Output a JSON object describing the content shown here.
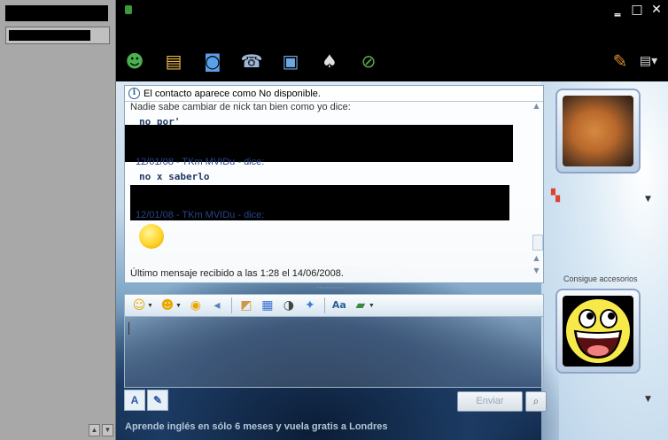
{
  "window": {
    "controls": [
      "minimize",
      "maximize",
      "close"
    ]
  },
  "toolbar": {
    "icons": [
      "invite-contact-icon",
      "send-files-icon",
      "video-icon",
      "call-icon",
      "activities-icon",
      "games-icon",
      "block-icon"
    ],
    "right_icons": [
      "paint-brush-icon",
      "menu-icon"
    ]
  },
  "history": {
    "info_text": "El contacto aparece como No disponible.",
    "lines": [
      "Nadie sabe cambiar de nick tan bien como yo dice:",
      "no por'",
      "12/01/08  -  TKm MVIDu  -  dice:",
      "no x saberlo",
      "12/01/08  -  TKm MVIDu  -  dice:"
    ],
    "last_message": "Último mensaje recibido a las 1:28 el 14/06/2008."
  },
  "format_toolbar": {
    "icons": [
      "emoticon-icon",
      "wink-icon",
      "nudge-icon",
      "voice-clip-icon",
      "background-icon",
      "color-picker-icon",
      "games-icon",
      "messenger-icon",
      "font-icon",
      "share-icon"
    ]
  },
  "input": {
    "send_label": "Enviar",
    "tab_labels": [
      "A",
      "✎"
    ]
  },
  "ad": {
    "text": "Aprende inglés en sólo 6 meses y vuela gratis a Londres"
  },
  "sidebar": {
    "accessories_label": "Consigue accesorios"
  },
  "colors": {
    "title_bar": "#000000",
    "panel_border": "#8aa7c2",
    "accent_blue": "#2d5f96"
  }
}
